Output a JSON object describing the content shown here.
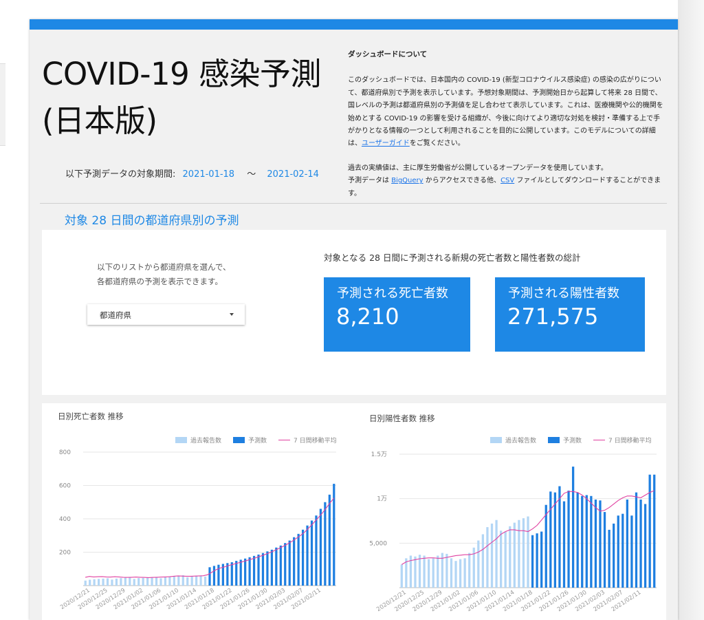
{
  "dashboard": {
    "title_line1": "COVID-19 感染予測",
    "title_line2": "(日本版)",
    "period_label": "以下予測データの対象期間:",
    "period_start": "2021-01-18",
    "period_sep": "〜",
    "period_end": "2021-02-14"
  },
  "about": {
    "heading": "ダッシュボードについて",
    "p1_text": "このダッシュボードでは、日本国内の COVID-19 (新型コロナウイルス感染症) の感染の広がりについて、都道府県別で予測を表示しています。予想対象期間は、予測開始日から起算して将来 28 日間で、国レベルの予測は都道府県別の予測値を足し合わせて表示しています。これは、医療機関や公的機関を始めとする COVID-19 の影響を受ける組織が、今後に向けてより適切な対処を検討・準備する上で手がかりとなる情報の一つとして利用されることを目的に公開しています。このモデルについての詳細は、",
    "p1_link": "ユーザーガイド",
    "p1_after": "をご覧ください。",
    "p2_line1": "過去の実績値は、主に厚生労働省が公開しているオープンデータを使用しています。",
    "p2_pre": "予測データは ",
    "p2_link1": "BigQuery",
    "p2_mid": " からアクセスできる他、",
    "p2_link2": "CSV",
    "p2_after": " ファイルとしてダウンロードすることができます。"
  },
  "section": {
    "title": "対象 28 日間の都道府県別の予測"
  },
  "selector": {
    "instruction_line1": "以下のリストから都道府県を選んで、",
    "instruction_line2": "各都道府県の予測を表示できます。",
    "dropdown_label": "都道府県"
  },
  "totals": {
    "heading": "対象となる 28 日間に予測される新規の死亡者数と陽性者数の総計",
    "deaths_label": "予測される死亡者数",
    "deaths_value": "8,210",
    "cases_label": "予測される陽性者数",
    "cases_value": "271,575"
  },
  "colors": {
    "accent": "#1e88e5",
    "past_bar": "#b3d6f5",
    "forecast_bar": "#1e7fe0",
    "moving_avg": "#e040a0"
  },
  "legend": {
    "past": "過去報告数",
    "forecast": "予測数",
    "avg": "7 日間移動平均"
  },
  "chart_data": [
    {
      "type": "bar",
      "title": "日別死亡者数 推移",
      "ylim": [
        0,
        800
      ],
      "yticks": [
        200,
        400,
        600,
        800
      ],
      "ytick_labels": [
        "200",
        "400",
        "600",
        "800"
      ],
      "xtick_labels": [
        "2020/12/21",
        "2020/12/25",
        "2020/12/29",
        "2021/01/02",
        "2021/01/06",
        "2021/01/10",
        "2021/01/14",
        "2021/01/18",
        "2021/01/22",
        "2021/01/26",
        "2021/01/30",
        "2021/02/03",
        "2021/02/07",
        "2021/02/11"
      ],
      "grid": true,
      "legend_position": "top-right",
      "series": [
        {
          "name": "過去報告数",
          "values": [
            30,
            35,
            38,
            40,
            42,
            44,
            36,
            42,
            45,
            48,
            50,
            40,
            45,
            46,
            48,
            50,
            52,
            44,
            50,
            55,
            58,
            60,
            62,
            50,
            56,
            60,
            58,
            54
          ]
        },
        {
          "name": "予測数",
          "values": [
            110,
            118,
            125,
            130,
            135,
            140,
            148,
            155,
            162,
            170,
            178,
            186,
            195,
            205,
            215,
            228,
            240,
            255,
            270,
            290,
            310,
            335,
            360,
            390,
            420,
            460,
            500,
            545,
            610
          ]
        },
        {
          "name": "7 日間移動平均",
          "values": [
            50,
            55,
            52,
            53,
            54,
            52,
            51,
            53,
            52,
            50,
            49,
            50,
            51,
            50,
            49,
            48,
            49,
            50,
            51,
            52,
            53,
            56,
            58,
            57,
            56,
            56,
            57,
            58,
            59,
            65,
            80,
            95,
            105,
            112,
            120,
            127,
            134,
            141,
            148,
            156,
            163,
            172,
            180,
            190,
            200,
            212,
            224,
            236,
            250,
            265,
            282,
            300,
            320,
            345,
            372,
            400,
            428,
            460,
            495,
            525
          ]
        }
      ]
    },
    {
      "type": "bar",
      "title": "日別陽性者数 推移",
      "ylim": [
        0,
        15000
      ],
      "yticks": [
        5000,
        10000,
        15000
      ],
      "ytick_labels": [
        "5,000",
        "1万",
        "1.5万"
      ],
      "xtick_labels": [
        "2020/12/21",
        "2020/12/25",
        "2020/12/29",
        "2021/01/02",
        "2021/01/06",
        "2021/01/10",
        "2021/01/14",
        "2021/01/18",
        "2021/01/22",
        "2021/01/26",
        "2021/01/30",
        "2021/02/03",
        "2021/02/07",
        "2021/02/11"
      ],
      "grid": true,
      "legend_position": "top-right",
      "series": [
        {
          "name": "過去報告数",
          "values": [
            2600,
            3300,
            3600,
            3500,
            3700,
            3600,
            3200,
            3300,
            3600,
            3900,
            3800,
            3300,
            3000,
            3200,
            3300,
            3900,
            4500,
            5300,
            6000,
            6800,
            7200,
            7600,
            6400,
            6300,
            6900,
            7300,
            7600,
            7800,
            8000
          ]
        },
        {
          "name": "予測数",
          "values": [
            5900,
            6100,
            6300,
            9300,
            10800,
            10700,
            11400,
            9700,
            10900,
            13600,
            10700,
            10300,
            10400,
            10300,
            9900,
            9800,
            8500,
            6500,
            7200,
            8100,
            8300,
            9900,
            8100,
            10700,
            9900,
            9400,
            12700,
            12700
          ]
        },
        {
          "name": "7 日間移動平均",
          "values": [
            2600,
            2900,
            3050,
            3150,
            3250,
            3300,
            3350,
            3350,
            3300,
            3300,
            3400,
            3500,
            3600,
            3650,
            3700,
            3700,
            3800,
            4000,
            4300,
            4700,
            5100,
            5500,
            6000,
            6300,
            6500,
            6500,
            6400,
            6400,
            6300,
            6600,
            7000,
            7600,
            8200,
            8800,
            9400,
            10000,
            10600,
            10800,
            10800,
            10700,
            10400,
            10000,
            9500,
            9000,
            8600,
            8700,
            9000,
            9400,
            9800,
            10100,
            10300,
            10300,
            10200,
            10100,
            10400,
            10700,
            10900
          ]
        }
      ]
    }
  ]
}
